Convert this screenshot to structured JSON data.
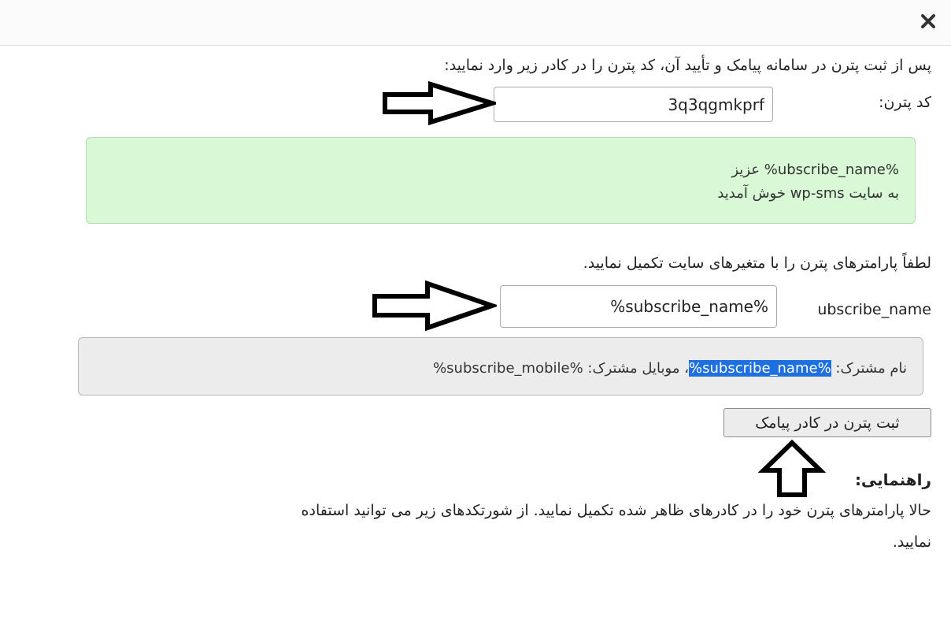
{
  "dialog": {
    "close_icon": "close-icon"
  },
  "intro_text": "پس از ثبت پترن در سامانه پیامک و تأیید آن، کد پترن را در کادر زیر وارد نمایید:",
  "pattern_code": {
    "label": "کد پترن:",
    "value": "3q3qgmkprf"
  },
  "preview_box": {
    "line1": "%ubscribe_name% عزیز",
    "line2": "به سایت wp-sms خوش آمدید"
  },
  "params_text": "لطفاً پارامترهای پترن را با متغیرهای سایت تکمیل نمایید.",
  "param_field": {
    "label": "ubscribe_name",
    "value": "%subscribe_name%"
  },
  "message_box": {
    "prefix": "نام مشترک: ",
    "highlight": "%subscribe_name%",
    "suffix": "، موبایل مشترک: %subscribe_mobile%"
  },
  "submit_button": {
    "label": "ثبت پترن در کادر پیامک"
  },
  "help": {
    "title": "راهنمایی:",
    "text_line1": "حالا پارامترهای پترن خود را در کادرهای ظاهر شده تکمیل نمایید. از شورتکدهای زیر می توانید استفاده",
    "text_line2": "نمایید."
  },
  "colors": {
    "preview_bg": "#d9f8d6",
    "message_bg": "#ececec",
    "highlight": "#1e6fe0"
  },
  "annotations": [
    "right-arrow",
    "right-arrow",
    "up-arrow"
  ]
}
